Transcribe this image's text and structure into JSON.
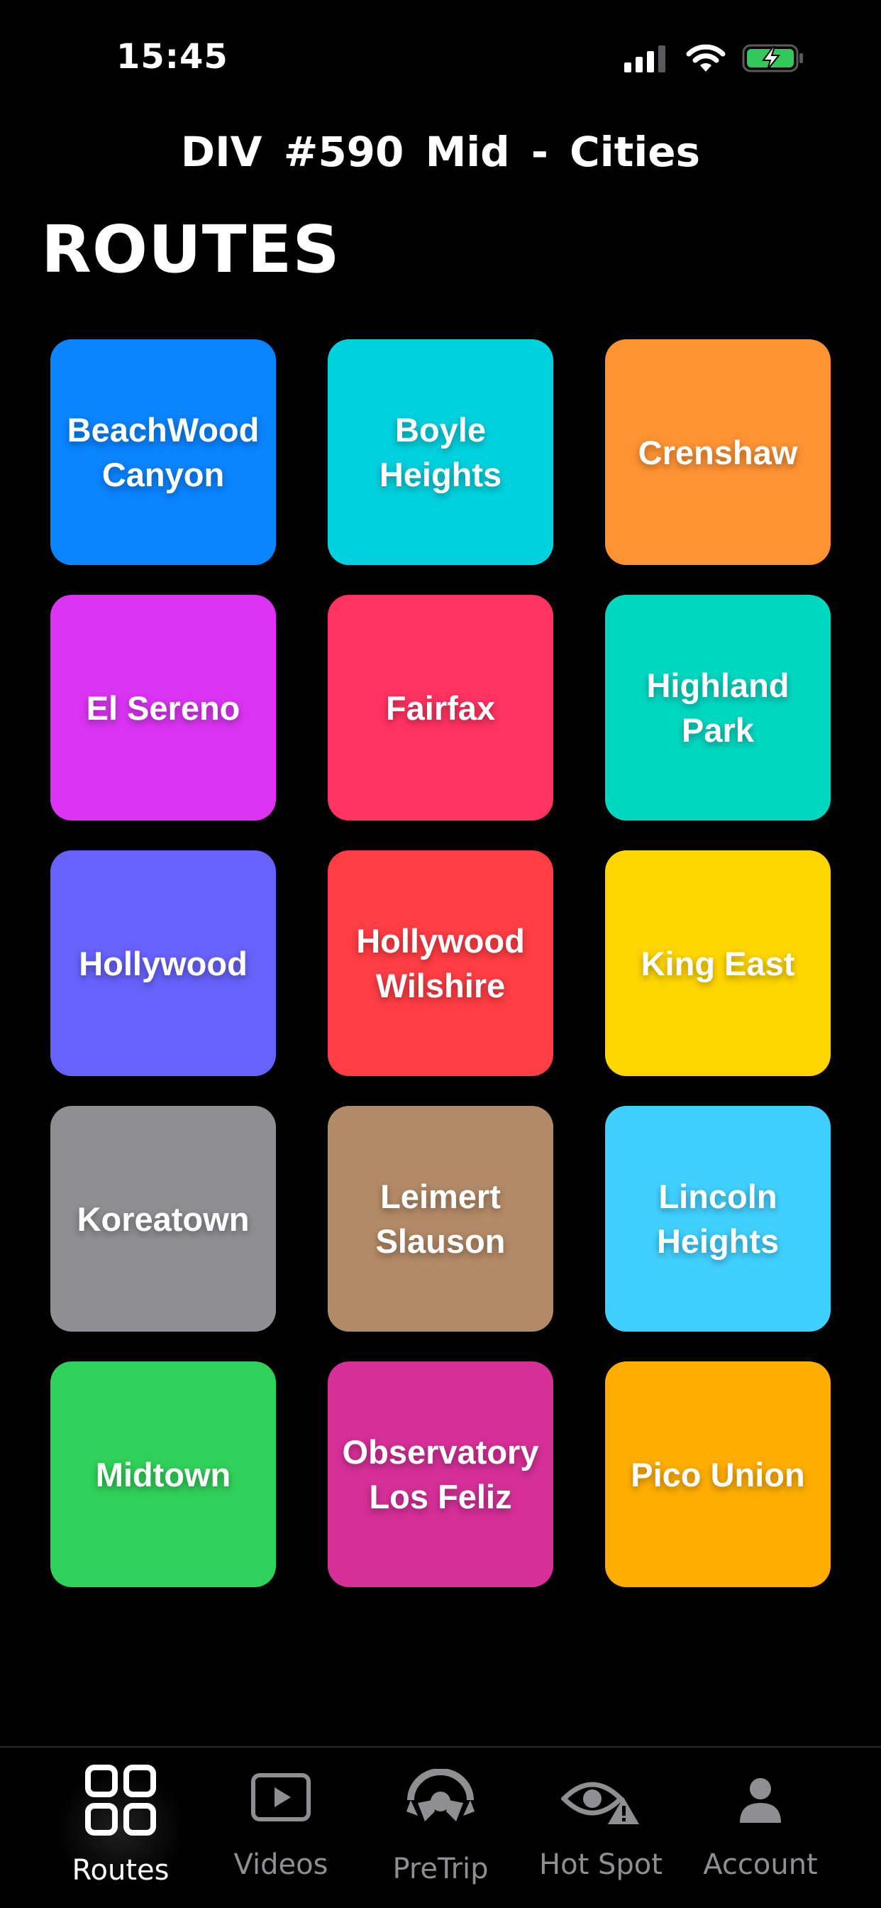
{
  "status_bar": {
    "time": "15:45",
    "icons": [
      "cellular-signal-icon",
      "wifi-icon",
      "battery-charging-icon"
    ],
    "battery_color": "#34c759"
  },
  "header": {
    "title": "DIV  #590  Mid - Cities"
  },
  "page": {
    "title": "ROUTES"
  },
  "routes": [
    {
      "label": "BeachWood\nCanyon",
      "color": "#0a84ff"
    },
    {
      "label": "Boyle\nHeights",
      "color": "#00d1de"
    },
    {
      "label": "Crenshaw",
      "color": "#ff9233"
    },
    {
      "label": "El Sereno",
      "color": "#da34f2"
    },
    {
      "label": "Fairfax",
      "color": "#ff335f"
    },
    {
      "label": "Highland\nPark",
      "color": "#00d7c1"
    },
    {
      "label": "Hollywood",
      "color": "#6762fb"
    },
    {
      "label": "Hollywood\nWilshire",
      "color": "#ff3d44"
    },
    {
      "label": "King East",
      "color": "#ffd600"
    },
    {
      "label": "Koreatown",
      "color": "#8e8e93"
    },
    {
      "label": "Leimert\nSlauson",
      "color": "#b38a66"
    },
    {
      "label": "Lincoln\nHeights",
      "color": "#40d0ff"
    },
    {
      "label": "Midtown",
      "color": "#30d158"
    },
    {
      "label": "Observatory\nLos Feliz",
      "color": "#d62f97"
    },
    {
      "label": "Pico Union",
      "color": "#ffae00"
    }
  ],
  "tab_bar": {
    "tabs": [
      {
        "label": "Routes",
        "icon": "grid-icon",
        "active": true
      },
      {
        "label": "Videos",
        "icon": "play-video-icon",
        "active": false
      },
      {
        "label": "PreTrip",
        "icon": "steering-wheel-icon",
        "active": false
      },
      {
        "label": "Hot Spot",
        "icon": "eye-warning-icon",
        "active": false
      },
      {
        "label": "Account",
        "icon": "person-icon",
        "active": false
      }
    ]
  }
}
